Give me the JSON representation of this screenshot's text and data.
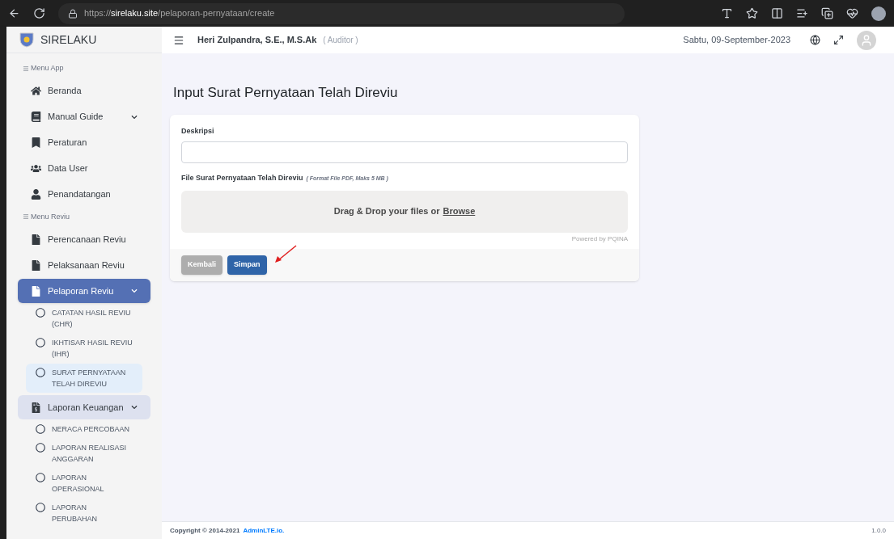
{
  "browser": {
    "url": "https://**sirelaku.site**/pelaporan-pernyataan/create"
  },
  "brand": {
    "name": "SIRELAKU"
  },
  "header": {
    "user_name": "Heri Zulpandra, S.E., M.S.Ak",
    "role": "( Auditor )",
    "date": "Sabtu, 09-September-2023"
  },
  "sidebar": {
    "sections": [
      {
        "title": "Menu App",
        "items": [
          {
            "label": "Beranda",
            "expandable": false,
            "expanded": false,
            "selected": false
          },
          {
            "label": "Manual Guide",
            "expandable": true,
            "expanded": false,
            "selected": false
          },
          {
            "label": "Peraturan",
            "expandable": false,
            "expanded": false,
            "selected": false
          },
          {
            "label": "Data User",
            "expandable": false,
            "expanded": false,
            "selected": false
          },
          {
            "label": "Penandatangan",
            "expandable": false,
            "expanded": false,
            "selected": false
          }
        ]
      },
      {
        "title": "Menu Reviu",
        "items": [
          {
            "label": "Perencanaan Reviu",
            "expandable": false,
            "expanded": false,
            "selected": false
          },
          {
            "label": "Pelaksanaan Reviu",
            "expandable": false,
            "expanded": false,
            "selected": false
          },
          {
            "label": "Pelaporan Reviu",
            "expandable": true,
            "expanded": true,
            "selected": true,
            "children": [
              {
                "label": "CATATAN HASIL REVIU (CHR)",
                "selected": false
              },
              {
                "label": "IKHTISAR HASIL REVIU (IHR)",
                "selected": false
              },
              {
                "label": "SURAT PERNYATAAN TELAH DIREVIU",
                "selected": true
              }
            ]
          },
          {
            "label": "Laporan Keuangan",
            "expandable": true,
            "expanded": true,
            "selected": false,
            "children": [
              {
                "label": "NERACA PERCOBAAN",
                "selected": false
              },
              {
                "label": "LAPORAN REALISASI ANGGARAN",
                "selected": false
              },
              {
                "label": "LAPORAN OPERASIONAL",
                "selected": false
              },
              {
                "label": "LAPORAN PERUBAHAN",
                "selected": false
              }
            ]
          }
        ]
      }
    ]
  },
  "page_title": "Input Surat Pernyataan Telah Direviu",
  "form": {
    "description_label": "Deskripsi",
    "file_label": "File Surat Pernyataan Telah Direviu",
    "file_hint": "( Format File PDF, Maks 5 MB )",
    "dropzone": {
      "text": "Drag & Drop your files or",
      "link": "Browse",
      "credit": "Powered by PQINA"
    },
    "buttons": [
      {
        "label": "Kembali",
        "kind": "secondary"
      },
      {
        "label": "Simpan",
        "kind": "primary"
      }
    ]
  },
  "footer": {
    "copyright": "Copyright © 2014-2021",
    "link": "AdminLTE.io.",
    "version": "1.0.0"
  }
}
